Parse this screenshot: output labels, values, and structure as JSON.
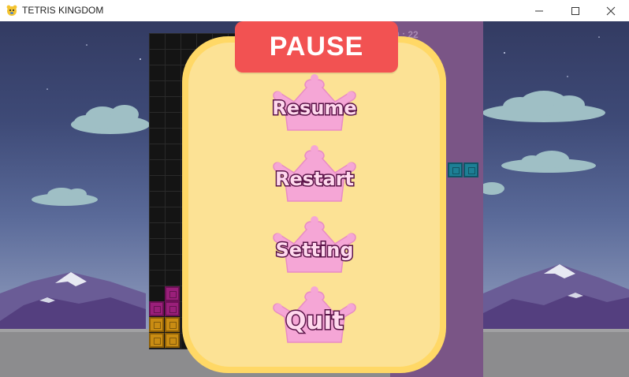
{
  "window": {
    "title": "TETRIS KINGDOM",
    "controls": [
      "minimize",
      "maximize",
      "close"
    ]
  },
  "game": {
    "timer": "0 : 22",
    "colors": {
      "sky_top": "#333b62",
      "board": "#141414",
      "side_panel": "#7a5586",
      "block_purple": "#9a1f7a",
      "block_gold": "#c98c13",
      "block_teal": "#1d7f95"
    }
  },
  "pause_menu": {
    "title": "PAUSE",
    "buttons": [
      {
        "label": "Resume",
        "icon": "crown-icon"
      },
      {
        "label": "Restart",
        "icon": "crown-icon"
      },
      {
        "label": "Setting",
        "icon": "crown-icon"
      },
      {
        "label": "Quit",
        "icon": "crown-icon"
      }
    ],
    "colors": {
      "banner": "#f25252",
      "panel_border": "#ffd866",
      "panel_fill": "#fce295",
      "crown": "#f5a6d6",
      "label_outline": "#5a1448"
    }
  }
}
